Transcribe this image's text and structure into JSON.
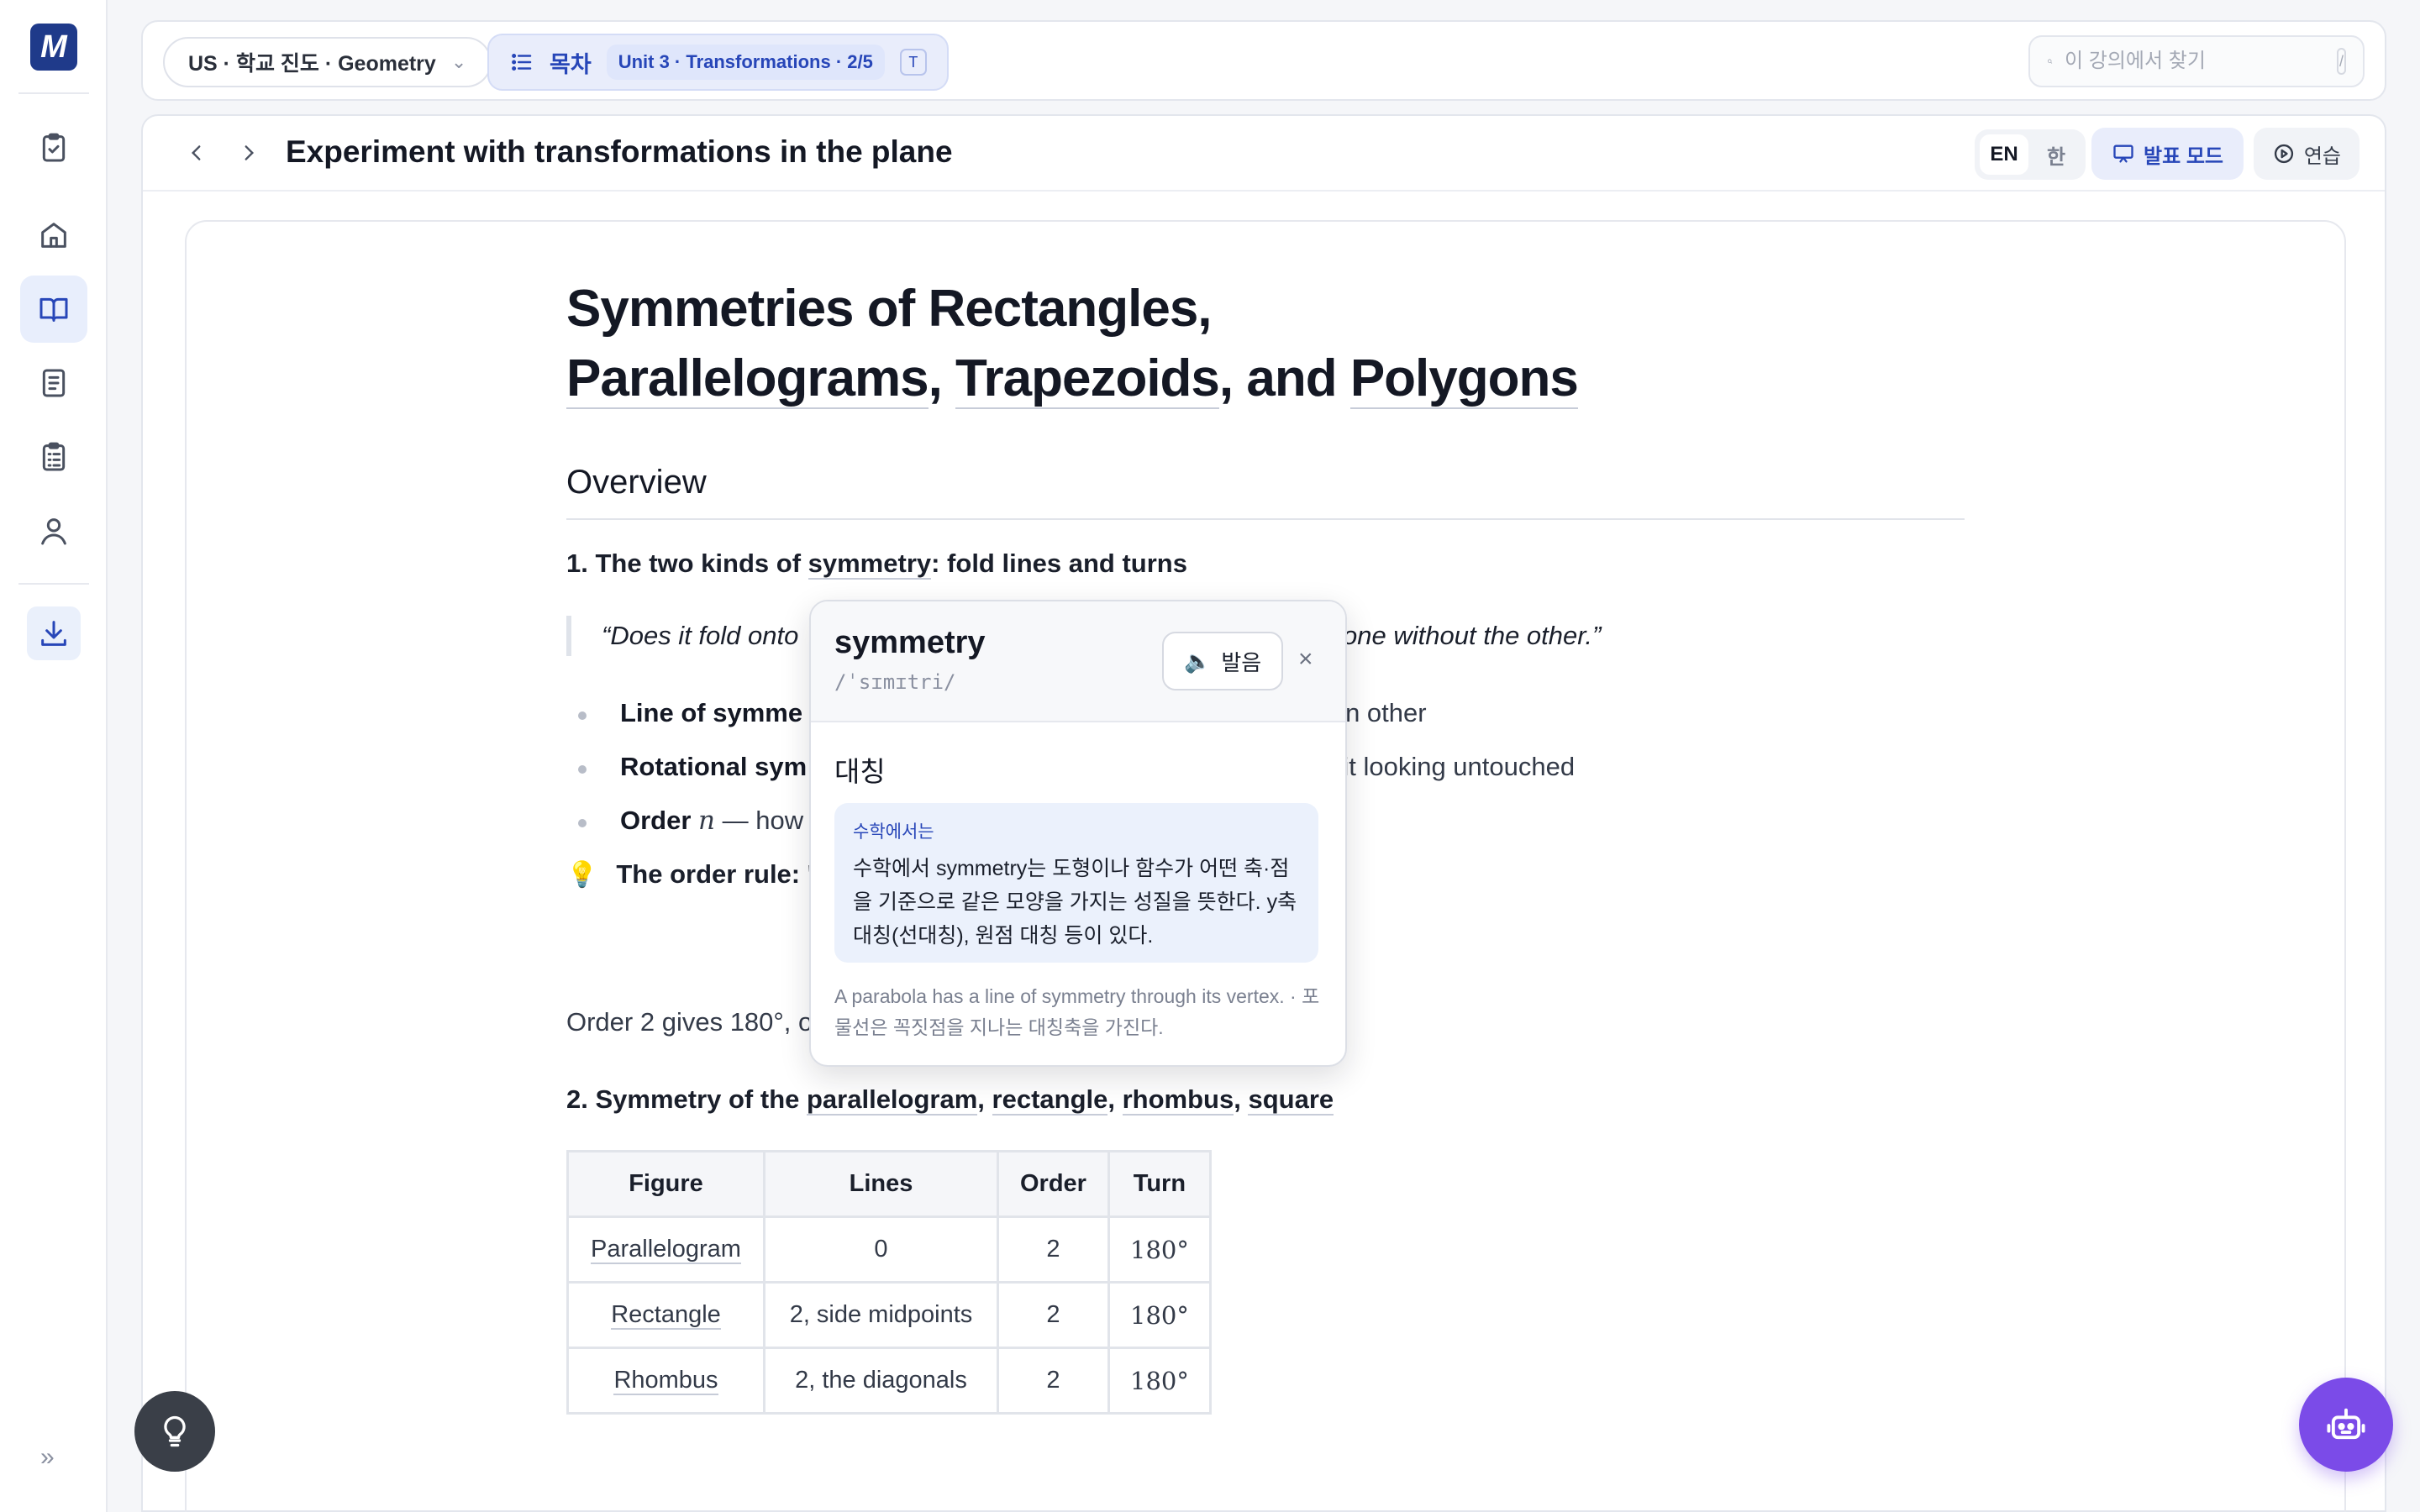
{
  "app": {
    "logo_letter": "M",
    "accent": "#2746b8",
    "brand": "#1f3a8a"
  },
  "rail": {
    "items": [
      {
        "name": "assignments",
        "icon": "clipboard-check-icon"
      },
      {
        "name": "home",
        "icon": "home-icon"
      },
      {
        "name": "lessons",
        "icon": "open-book-icon",
        "active": true
      },
      {
        "name": "notes",
        "icon": "notebook-icon"
      },
      {
        "name": "checklist",
        "icon": "checklist-icon"
      },
      {
        "name": "profile",
        "icon": "user-icon"
      },
      {
        "name": "download",
        "icon": "download-icon"
      }
    ],
    "expand_glyph": "»"
  },
  "topbar": {
    "breadcrumb": "US · 학교 진도 · Geometry",
    "toc_label": "목차",
    "toc_unit": "Unit 3 · Transformations · 2/5",
    "toc_shortcut": "T",
    "search_placeholder": "이 강의에서 찾기",
    "search_shortcut": "/"
  },
  "header": {
    "title": "Experiment with transformations in the plane",
    "lang_en": "EN",
    "lang_ko": "한",
    "present_label": "발표 모드",
    "practice_label": "연습"
  },
  "doc": {
    "title_line1": "Symmetries of Rectangles,",
    "title_line2_a": "Parallelograms",
    "title_line2_b": ", ",
    "title_line2_c": "Trapezoids",
    "title_line2_d": ", and ",
    "title_line2_e": "Polygons",
    "overview": "Overview",
    "sec1_a": "1. The two kinds of ",
    "sec1_b": "symmetry",
    "sec1_c": ": fold lines and turns",
    "quote_start": "“Does it fold onto",
    "quote_end": "n have one without the other.”",
    "bullets": [
      {
        "bold": "Line of symme",
        "rest_visible": "n other"
      },
      {
        "bold": "Rotational sym",
        "rest_visible": "s it looking untouched"
      },
      {
        "bold": "Order ",
        "math": "n",
        "rest": " — how"
      }
    ],
    "tip_bold": "The order rule: '",
    "para_text": "Order 2 gives 180°, order 4 gives 90°, order 6 gives 60°.",
    "sec2_a": "2. Symmetry of the ",
    "sec2_b": "parallelogram",
    "sec2_c": ", ",
    "sec2_d": "rectangle",
    "sec2_e": ", ",
    "sec2_f": "rhombus",
    "sec2_g": ", ",
    "sec2_h": "square",
    "table": {
      "headers": [
        "Figure",
        "Lines",
        "Order",
        "Turn"
      ],
      "rows": [
        {
          "figure": "Parallelogram",
          "lines": "0",
          "order": "2",
          "turn": "180°"
        },
        {
          "figure": "Rectangle",
          "lines": "2, side midpoints",
          "order": "2",
          "turn": "180°"
        },
        {
          "figure": "Rhombus",
          "lines": "2, the diagonals",
          "order": "2",
          "turn": "180°"
        }
      ]
    }
  },
  "popup": {
    "word": "symmetry",
    "ipa": "/ˈsɪmɪtri/",
    "speak_label": "발음",
    "close_glyph": "×",
    "korean": "대칭",
    "context_tag": "수학에서는",
    "definition": "수학에서 symmetry는 도형이나 함수가 어떤 축·점을 기준으로 같은 모양을 가지는 성질을 뜻한다. y축 대칭(선대칭), 원점 대칭 등이 있다.",
    "example": "A parabola has a line of symmetry through its vertex. · 포물선은 꼭짓점을 지나는 대칭축을 가진다."
  }
}
